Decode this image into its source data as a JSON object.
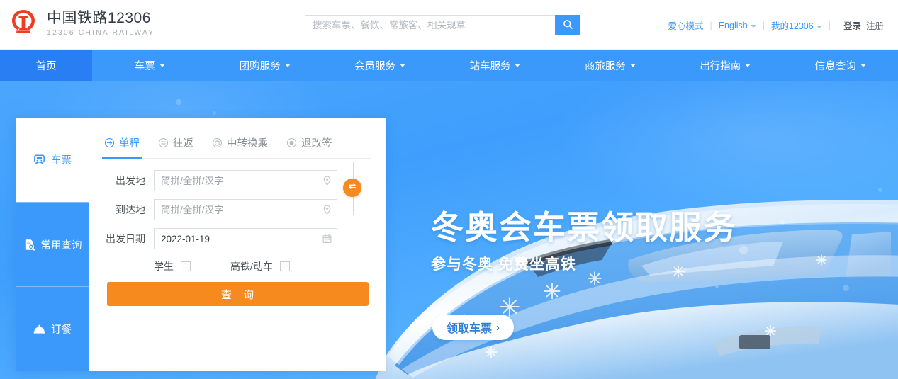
{
  "brand": {
    "name_cn": "中国铁路12306",
    "name_en": "12306 CHINA RAILWAY",
    "logo_icon": "railway-emblem-icon",
    "logo_color": "#ef3c22"
  },
  "search": {
    "placeholder": "搜索车票、餐饮、常旅客、相关规章",
    "value": "",
    "button_icon": "search-icon",
    "button_color": "#3b99fc"
  },
  "top_links": {
    "accessibility": "爱心模式",
    "language": "English",
    "account": "我的12306",
    "login": "登录",
    "register": "注册",
    "separator": "|"
  },
  "nav": {
    "background": "#3b99fc",
    "active_background": "#2a7ef3",
    "items": [
      {
        "label": "首页",
        "has_caret": false,
        "active": true
      },
      {
        "label": "车票",
        "has_caret": true,
        "active": false
      },
      {
        "label": "团购服务",
        "has_caret": true,
        "active": false
      },
      {
        "label": "会员服务",
        "has_caret": true,
        "active": false
      },
      {
        "label": "站车服务",
        "has_caret": true,
        "active": false
      },
      {
        "label": "商旅服务",
        "has_caret": true,
        "active": false
      },
      {
        "label": "出行指南",
        "has_caret": true,
        "active": false
      },
      {
        "label": "信息查询",
        "has_caret": true,
        "active": false
      }
    ]
  },
  "banner": {
    "title": "冬奥会车票领取服务",
    "subtitle": "参与冬奥 免费坐高铁",
    "cta_label": "领取车票",
    "cta_chevron": "›",
    "image_subject": "high-speed-train-with-snowflakes",
    "background_color": "#4aa6fd"
  },
  "panel": {
    "sidebar": [
      {
        "label": "车票",
        "icon": "train-ticket-icon",
        "active": true
      },
      {
        "label": "常用查询",
        "icon": "query-document-icon",
        "active": false
      },
      {
        "label": "订餐",
        "icon": "meal-cloche-icon",
        "active": false
      }
    ],
    "tabs": [
      {
        "label": "单程",
        "icon": "one-way-arrow-icon",
        "active": true
      },
      {
        "label": "往返",
        "icon": "round-trip-icon",
        "active": false
      },
      {
        "label": "中转换乘",
        "icon": "transfer-refresh-icon",
        "active": false
      },
      {
        "label": "退改签",
        "icon": "refund-icon",
        "active": false
      }
    ],
    "form": {
      "origin": {
        "label": "出发地",
        "placeholder": "简拼/全拼/汉字",
        "value": "",
        "icon": "location-pin-icon"
      },
      "destination": {
        "label": "到达地",
        "placeholder": "简拼/全拼/汉字",
        "value": "",
        "icon": "location-pin-icon"
      },
      "depart_date": {
        "label": "出发日期",
        "value": "2022-01-19",
        "placeholder": "",
        "icon": "calendar-icon"
      },
      "swap": {
        "icon": "swap-arrows-icon",
        "color": "#f68a1e"
      },
      "student": {
        "label": "学生",
        "checked": false
      },
      "high_speed": {
        "label": "高铁/动车",
        "checked": false
      },
      "submit_label": "查 询",
      "submit_color": "#f68a1e"
    }
  }
}
